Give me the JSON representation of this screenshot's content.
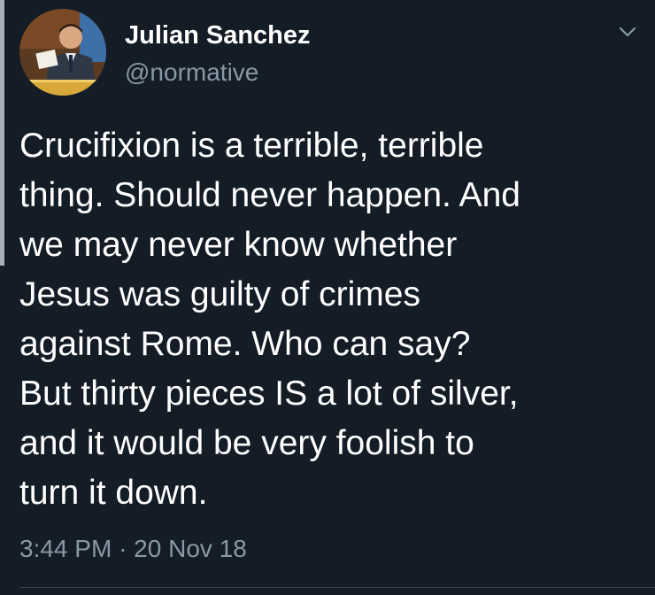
{
  "user": {
    "display_name": "Julian Sanchez",
    "handle": "@normative"
  },
  "tweet": {
    "lines": [
      "Crucifixion is a terrible, terrible",
      "thing. Should never happen. And",
      "we may never know whether",
      "Jesus was guilty of crimes",
      "against Rome. Who can say?",
      "But thirty pieces IS a lot of silver,",
      "and it would be very foolish to",
      "turn it down."
    ],
    "time": "3:44 PM",
    "separator": "·",
    "date": "20 Nov 18"
  },
  "icons": {
    "menu": "chevron-down-icon",
    "avatar": "avatar-photo"
  },
  "colors": {
    "background": "#141d26",
    "text": "#ffffff",
    "secondary_text": "#8899a6",
    "divider": "#38444d"
  }
}
